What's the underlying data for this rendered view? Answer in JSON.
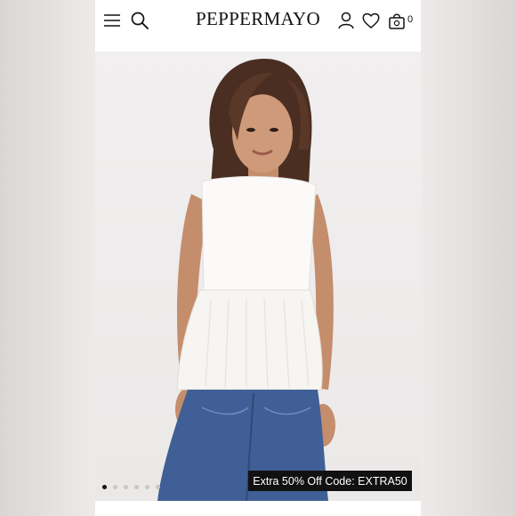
{
  "brand": {
    "logo_text": "PEPPERMAYO"
  },
  "header": {
    "menu_icon": "hamburger-menu-icon",
    "search_icon": "search-icon",
    "account_icon": "user-icon",
    "wishlist_icon": "heart-icon",
    "bag_icon": "shopping-bag-icon",
    "bag_count": "0"
  },
  "product_gallery": {
    "promo_banner": "Extra 50% Off Code: EXTRA50",
    "image_count": 6,
    "active_image_index": 0
  },
  "colors": {
    "background": "#ffffff",
    "text": "#111111",
    "promo_background": "#111111",
    "promo_text": "#ffffff",
    "dot_inactive": "#c9c6c6",
    "dot_active": "#111111"
  }
}
